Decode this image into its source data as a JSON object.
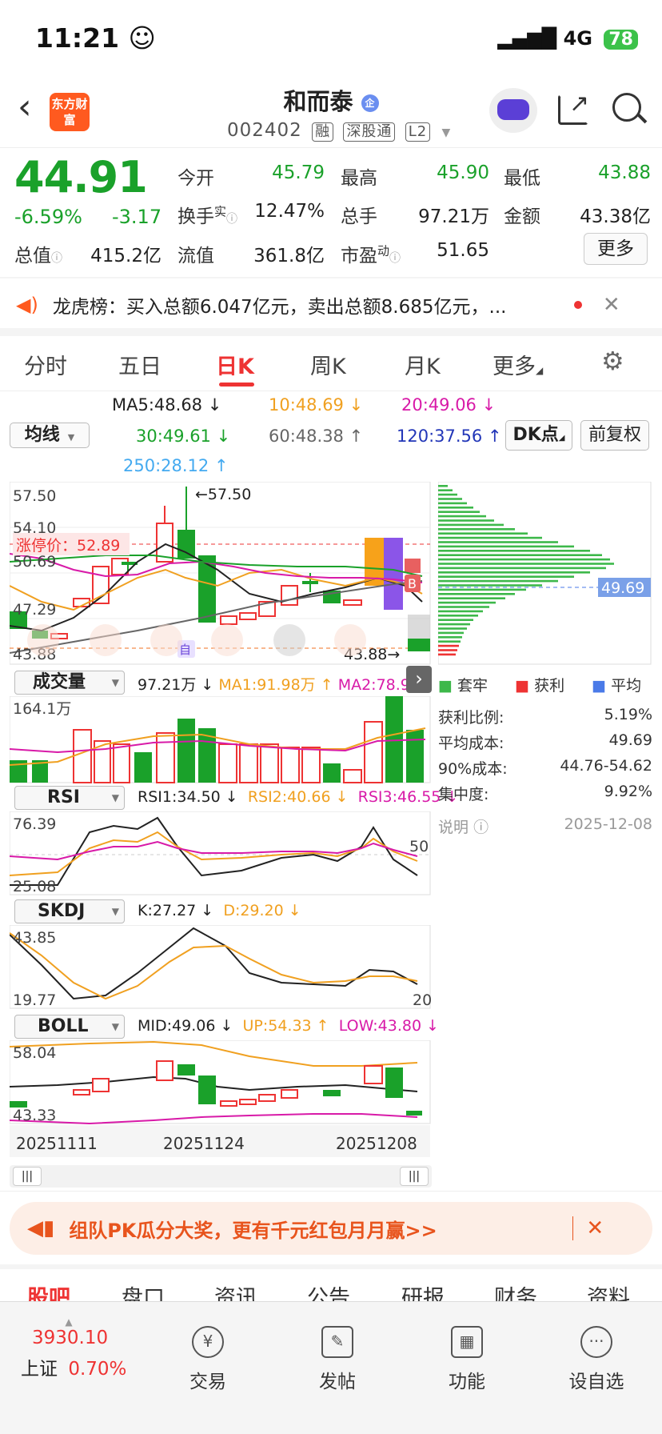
{
  "status_bar": {
    "time": "11:21",
    "network": "4G",
    "battery": "78"
  },
  "header": {
    "logo_text": "东方财富",
    "title": "和而泰",
    "code": "002402",
    "tags": [
      "融",
      "深股通",
      "L2"
    ]
  },
  "quote": {
    "price": "44.91",
    "change_pct": "-6.59%",
    "change": "-3.17",
    "fields": [
      {
        "label": "今开",
        "value": "45.79"
      },
      {
        "label": "最高",
        "value": "45.90"
      },
      {
        "label": "最低",
        "value": "43.88"
      },
      {
        "label": "换手",
        "sup": "实",
        "value": "12.47%"
      },
      {
        "label": "总手",
        "value": "97.21万"
      },
      {
        "label": "金额",
        "value": "43.38亿"
      },
      {
        "label": "总值",
        "value": "415.2亿"
      },
      {
        "label": "流值",
        "value": "361.8亿"
      },
      {
        "label": "市盈",
        "sup": "动",
        "value": "51.65"
      }
    ],
    "more_label": "更多"
  },
  "notice": {
    "text": "龙虎榜：买入总额6.047亿元，卖出总额8.685亿元，..."
  },
  "tabs": [
    "分时",
    "五日",
    "日K",
    "周K",
    "月K",
    "更多"
  ],
  "active_tab": "日K",
  "ma": {
    "selector": "均线",
    "ma5": "MA5:48.68 ↓",
    "ma10": "10:48.69 ↓",
    "ma20": "20:49.06 ↓",
    "ma30": "30:49.61 ↓",
    "ma60": "60:48.38 ↑",
    "ma120": "120:37.56 ↑",
    "ma250": "250:28.12 ↑",
    "dk_label": "DK点",
    "fq_label": "前复权"
  },
  "kline": {
    "y_high": "57.50",
    "y2": "54.10",
    "y3": "50.69",
    "y4": "47.29",
    "y_low": "43.88",
    "limit_up": "涨停价：52.89",
    "max_label": "←57.50",
    "min_label": "43.88→",
    "chip_cost": "49.69",
    "marker_b": "B",
    "marker_zi": "自"
  },
  "volume": {
    "selector": "成交量",
    "v1": "97.21万 ↓",
    "v2": "MA1:91.98万 ↑",
    "v3": "MA2:78.90万",
    "top": "164.1万"
  },
  "rsi": {
    "selector": "RSI",
    "v1": "RSI1:34.50 ↓",
    "v2": "RSI2:40.66 ↓",
    "v3": "RSI3:46.55 ↓",
    "top": "76.39",
    "bottom": "25.08",
    "mid": "50"
  },
  "skdj": {
    "selector": "SKDJ",
    "v1": "K:27.27 ↓",
    "v2": "D:29.20 ↓",
    "top": "43.85",
    "bottom": "19.77",
    "mark": "20"
  },
  "boll": {
    "selector": "BOLL",
    "v1": "MID:49.06 ↓",
    "v2": "UP:54.33 ↑",
    "v3": "LOW:43.80 ↓",
    "top": "58.04",
    "bottom": "43.33"
  },
  "dates": [
    "20251111",
    "20251124",
    "20251208"
  ],
  "chip": {
    "legend": [
      "套牢",
      "获利",
      "平均"
    ],
    "rows": [
      {
        "label": "获利比例:",
        "value": "5.19%"
      },
      {
        "label": "平均成本:",
        "value": "49.69"
      },
      {
        "label": "90%成本:",
        "value": "44.76-54.62"
      },
      {
        "label": "集中度:",
        "value": "9.92%"
      }
    ],
    "note_label": "说明",
    "note_date": "2025-12-08"
  },
  "banner": {
    "text": "组队PK瓜分大奖，更有千元红包月月赢>>"
  },
  "bottom_tabs": [
    "股吧",
    "盘口",
    "资讯",
    "公告",
    "研报",
    "财务",
    "资料"
  ],
  "nav": {
    "index_value": "3930.10",
    "index_name": "上证",
    "index_change": "0.70%",
    "items": [
      "交易",
      "发帖",
      "功能",
      "设自选"
    ]
  },
  "colors": {
    "up": "#e33333",
    "down": "#1aa12a",
    "accent": "#ff5a1f"
  }
}
